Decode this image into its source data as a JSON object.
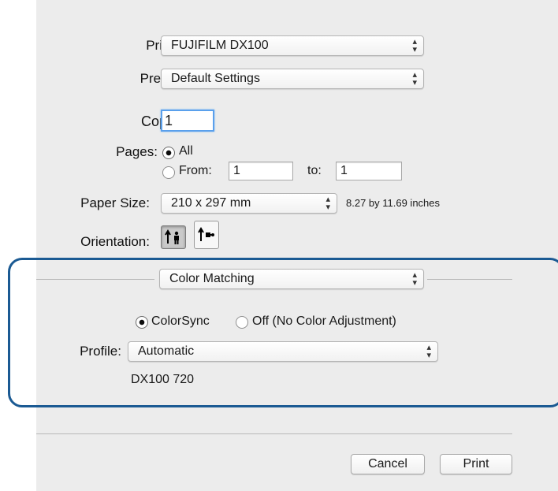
{
  "printer": {
    "label": "Printer:",
    "value": "FUJIFILM DX100"
  },
  "presets": {
    "label": "Presets:",
    "value": "Default Settings"
  },
  "copies": {
    "label": "Copies:",
    "value": "1"
  },
  "pages": {
    "label": "Pages:",
    "all_label": "All",
    "from_label": "From:",
    "from_value": "1",
    "to_label": "to:",
    "to_value": "1",
    "selected": "All"
  },
  "paper_size": {
    "label": "Paper Size:",
    "value": "210 x 297 mm",
    "dimensions": "8.27 by 11.69 inches"
  },
  "orientation": {
    "label": "Orientation:",
    "selected": "portrait"
  },
  "section": {
    "value": "Color Matching"
  },
  "color_matching": {
    "colorsync_label": "ColorSync",
    "off_label": "Off (No Color Adjustment)",
    "selected": "ColorSync",
    "profile_label": "Profile:",
    "profile_value": "Automatic",
    "profile_name": "DX100 720"
  },
  "buttons": {
    "cancel": "Cancel",
    "print": "Print"
  },
  "colors": {
    "focus_ring": "#5aa0ec",
    "highlight_border": "#1b5a93",
    "dialog_bg": "#ececec"
  },
  "icons": {
    "popup_arrows": "up-down-arrows-icon"
  }
}
